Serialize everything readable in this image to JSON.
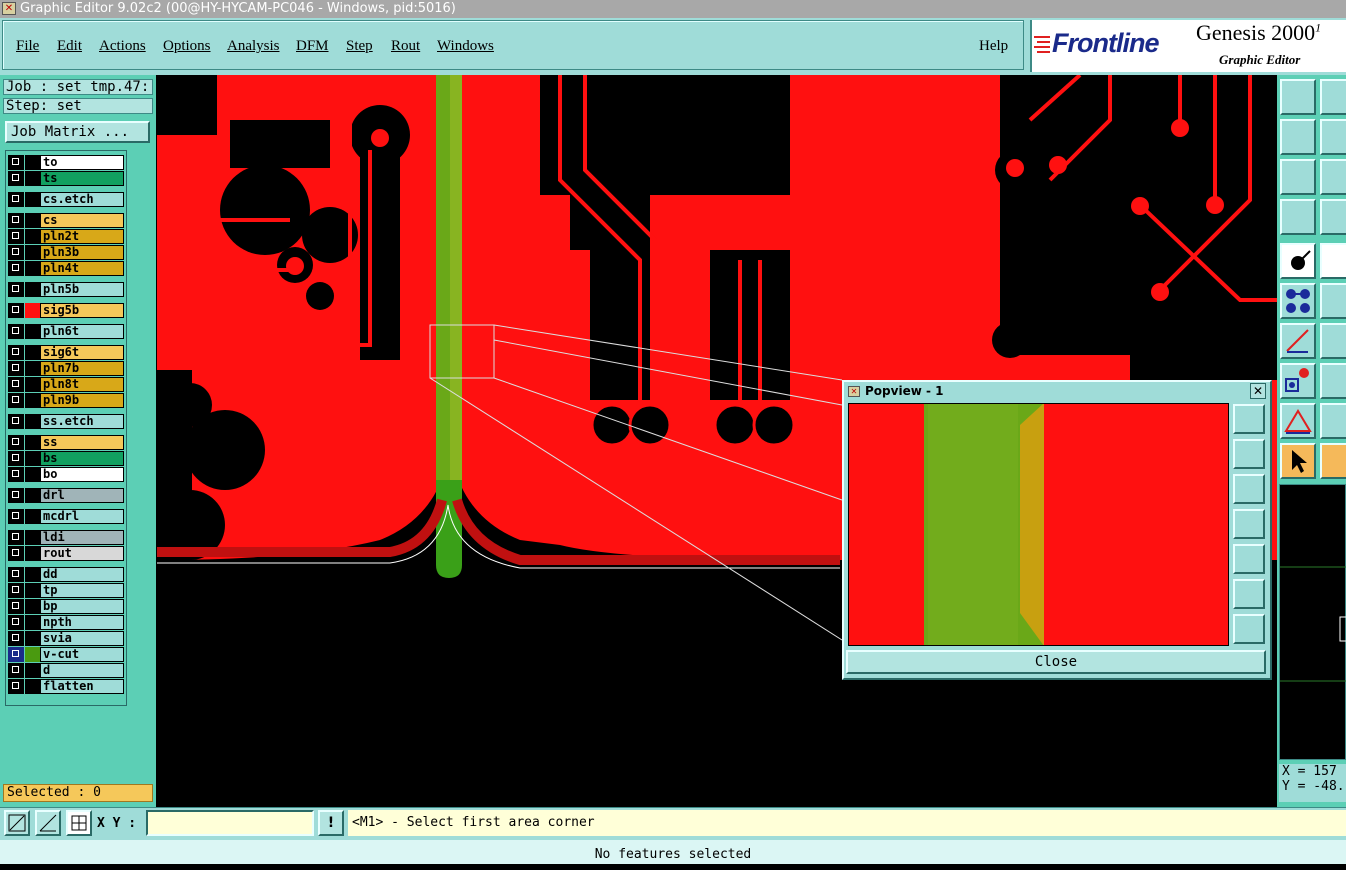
{
  "window": {
    "title": "Graphic Editor 9.02c2 (00@HY-HYCAM-PC046 - Windows, pid:5016)"
  },
  "menu": {
    "items": [
      "File",
      "Edit",
      "Actions",
      "Options",
      "Analysis",
      "DFM",
      "Step",
      "Rout",
      "Windows"
    ],
    "help": "Help"
  },
  "brand": {
    "logo": "Frontline",
    "product": "Genesis 2000",
    "product_sup": "1",
    "subtitle": "Graphic Editor"
  },
  "job": {
    "job_label": "Job : set_tmp.47:",
    "step_label": "Step: set",
    "matrix_button": "Job Matrix ..."
  },
  "layers": [
    {
      "name": "to",
      "color": "#ffffff",
      "swatch": ""
    },
    {
      "name": "ts",
      "color": "#11a060",
      "swatch": ""
    },
    {
      "name": "cs.etch",
      "color": "#9fdcd8",
      "swatch": ""
    },
    {
      "name": "cs",
      "color": "#f5c85a",
      "swatch": ""
    },
    {
      "name": "pln2t",
      "color": "#d8a818",
      "swatch": ""
    },
    {
      "name": "pln3b",
      "color": "#d8a818",
      "swatch": ""
    },
    {
      "name": "pln4t",
      "color": "#d8a818",
      "swatch": ""
    },
    {
      "name": "pln5b",
      "color": "#9fdcd8",
      "swatch": ""
    },
    {
      "name": "sig5b",
      "color": "#f5c85a",
      "swatch": "#ff1010"
    },
    {
      "name": "pln6t",
      "color": "#9fdcd8",
      "swatch": ""
    },
    {
      "name": "sig6t",
      "color": "#f5c85a",
      "swatch": ""
    },
    {
      "name": "pln7b",
      "color": "#d8a818",
      "swatch": ""
    },
    {
      "name": "pln8t",
      "color": "#d8a818",
      "swatch": ""
    },
    {
      "name": "pln9b",
      "color": "#d8a818",
      "swatch": ""
    },
    {
      "name": "ss.etch",
      "color": "#9fdcd8",
      "swatch": ""
    },
    {
      "name": "ss",
      "color": "#f5c85a",
      "swatch": ""
    },
    {
      "name": "bs",
      "color": "#11a060",
      "swatch": ""
    },
    {
      "name": "bo",
      "color": "#ffffff",
      "swatch": ""
    },
    {
      "name": "drl",
      "color": "#a0b4b8",
      "swatch": ""
    },
    {
      "name": "mcdrl",
      "color": "#9fdcd8",
      "swatch": ""
    },
    {
      "name": "ldi",
      "color": "#a0b4b8",
      "swatch": ""
    },
    {
      "name": "rout",
      "color": "#d8d8d8",
      "swatch": ""
    },
    {
      "name": "dd",
      "color": "#9fdcd8",
      "swatch": ""
    },
    {
      "name": "tp",
      "color": "#9fdcd8",
      "swatch": ""
    },
    {
      "name": "bp",
      "color": "#9fdcd8",
      "swatch": ""
    },
    {
      "name": "npth",
      "color": "#9fdcd8",
      "swatch": ""
    },
    {
      "name": "svia",
      "color": "#9fdcd8",
      "swatch": ""
    },
    {
      "name": "v-cut",
      "color": "#9fdcd8",
      "swatch": "#4a9a10",
      "active": true
    },
    {
      "name": "d",
      "color": "#9fdcd8",
      "swatch": ""
    },
    {
      "name": "flatten",
      "color": "#9fdcd8",
      "swatch": ""
    }
  ],
  "selected_label": "Selected : 0",
  "input": {
    "xy_label": "X Y :",
    "xy_value": "",
    "prompt": "<M1> - Select first area corner"
  },
  "status": "No features selected",
  "coords": {
    "x": "X = 157",
    "y": "Y = -48."
  },
  "popview": {
    "title": "Popview - 1",
    "close_label": "Close"
  },
  "colors": {
    "copper": "#ff1010",
    "vcut": "#6aa818",
    "plane": "#c8a010",
    "panel": "#5ccfb5",
    "toolbar": "#9fdcd8"
  }
}
